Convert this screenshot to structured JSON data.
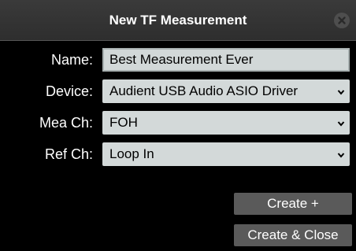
{
  "dialog": {
    "title": "New TF Measurement",
    "close_icon": "close-icon"
  },
  "form": {
    "name": {
      "label": "Name:",
      "value": "Best Measurement Ever"
    },
    "device": {
      "label": "Device:",
      "value": "Audient USB Audio ASIO Driver"
    },
    "mea_ch": {
      "label": "Mea Ch:",
      "value": "FOH"
    },
    "ref_ch": {
      "label": "Ref Ch:",
      "value": "Loop In"
    }
  },
  "buttons": {
    "create": "Create +",
    "create_close": "Create & Close"
  },
  "colors": {
    "background": "#000000",
    "field": "#d3d9d9",
    "button": "#5a5a5a"
  }
}
